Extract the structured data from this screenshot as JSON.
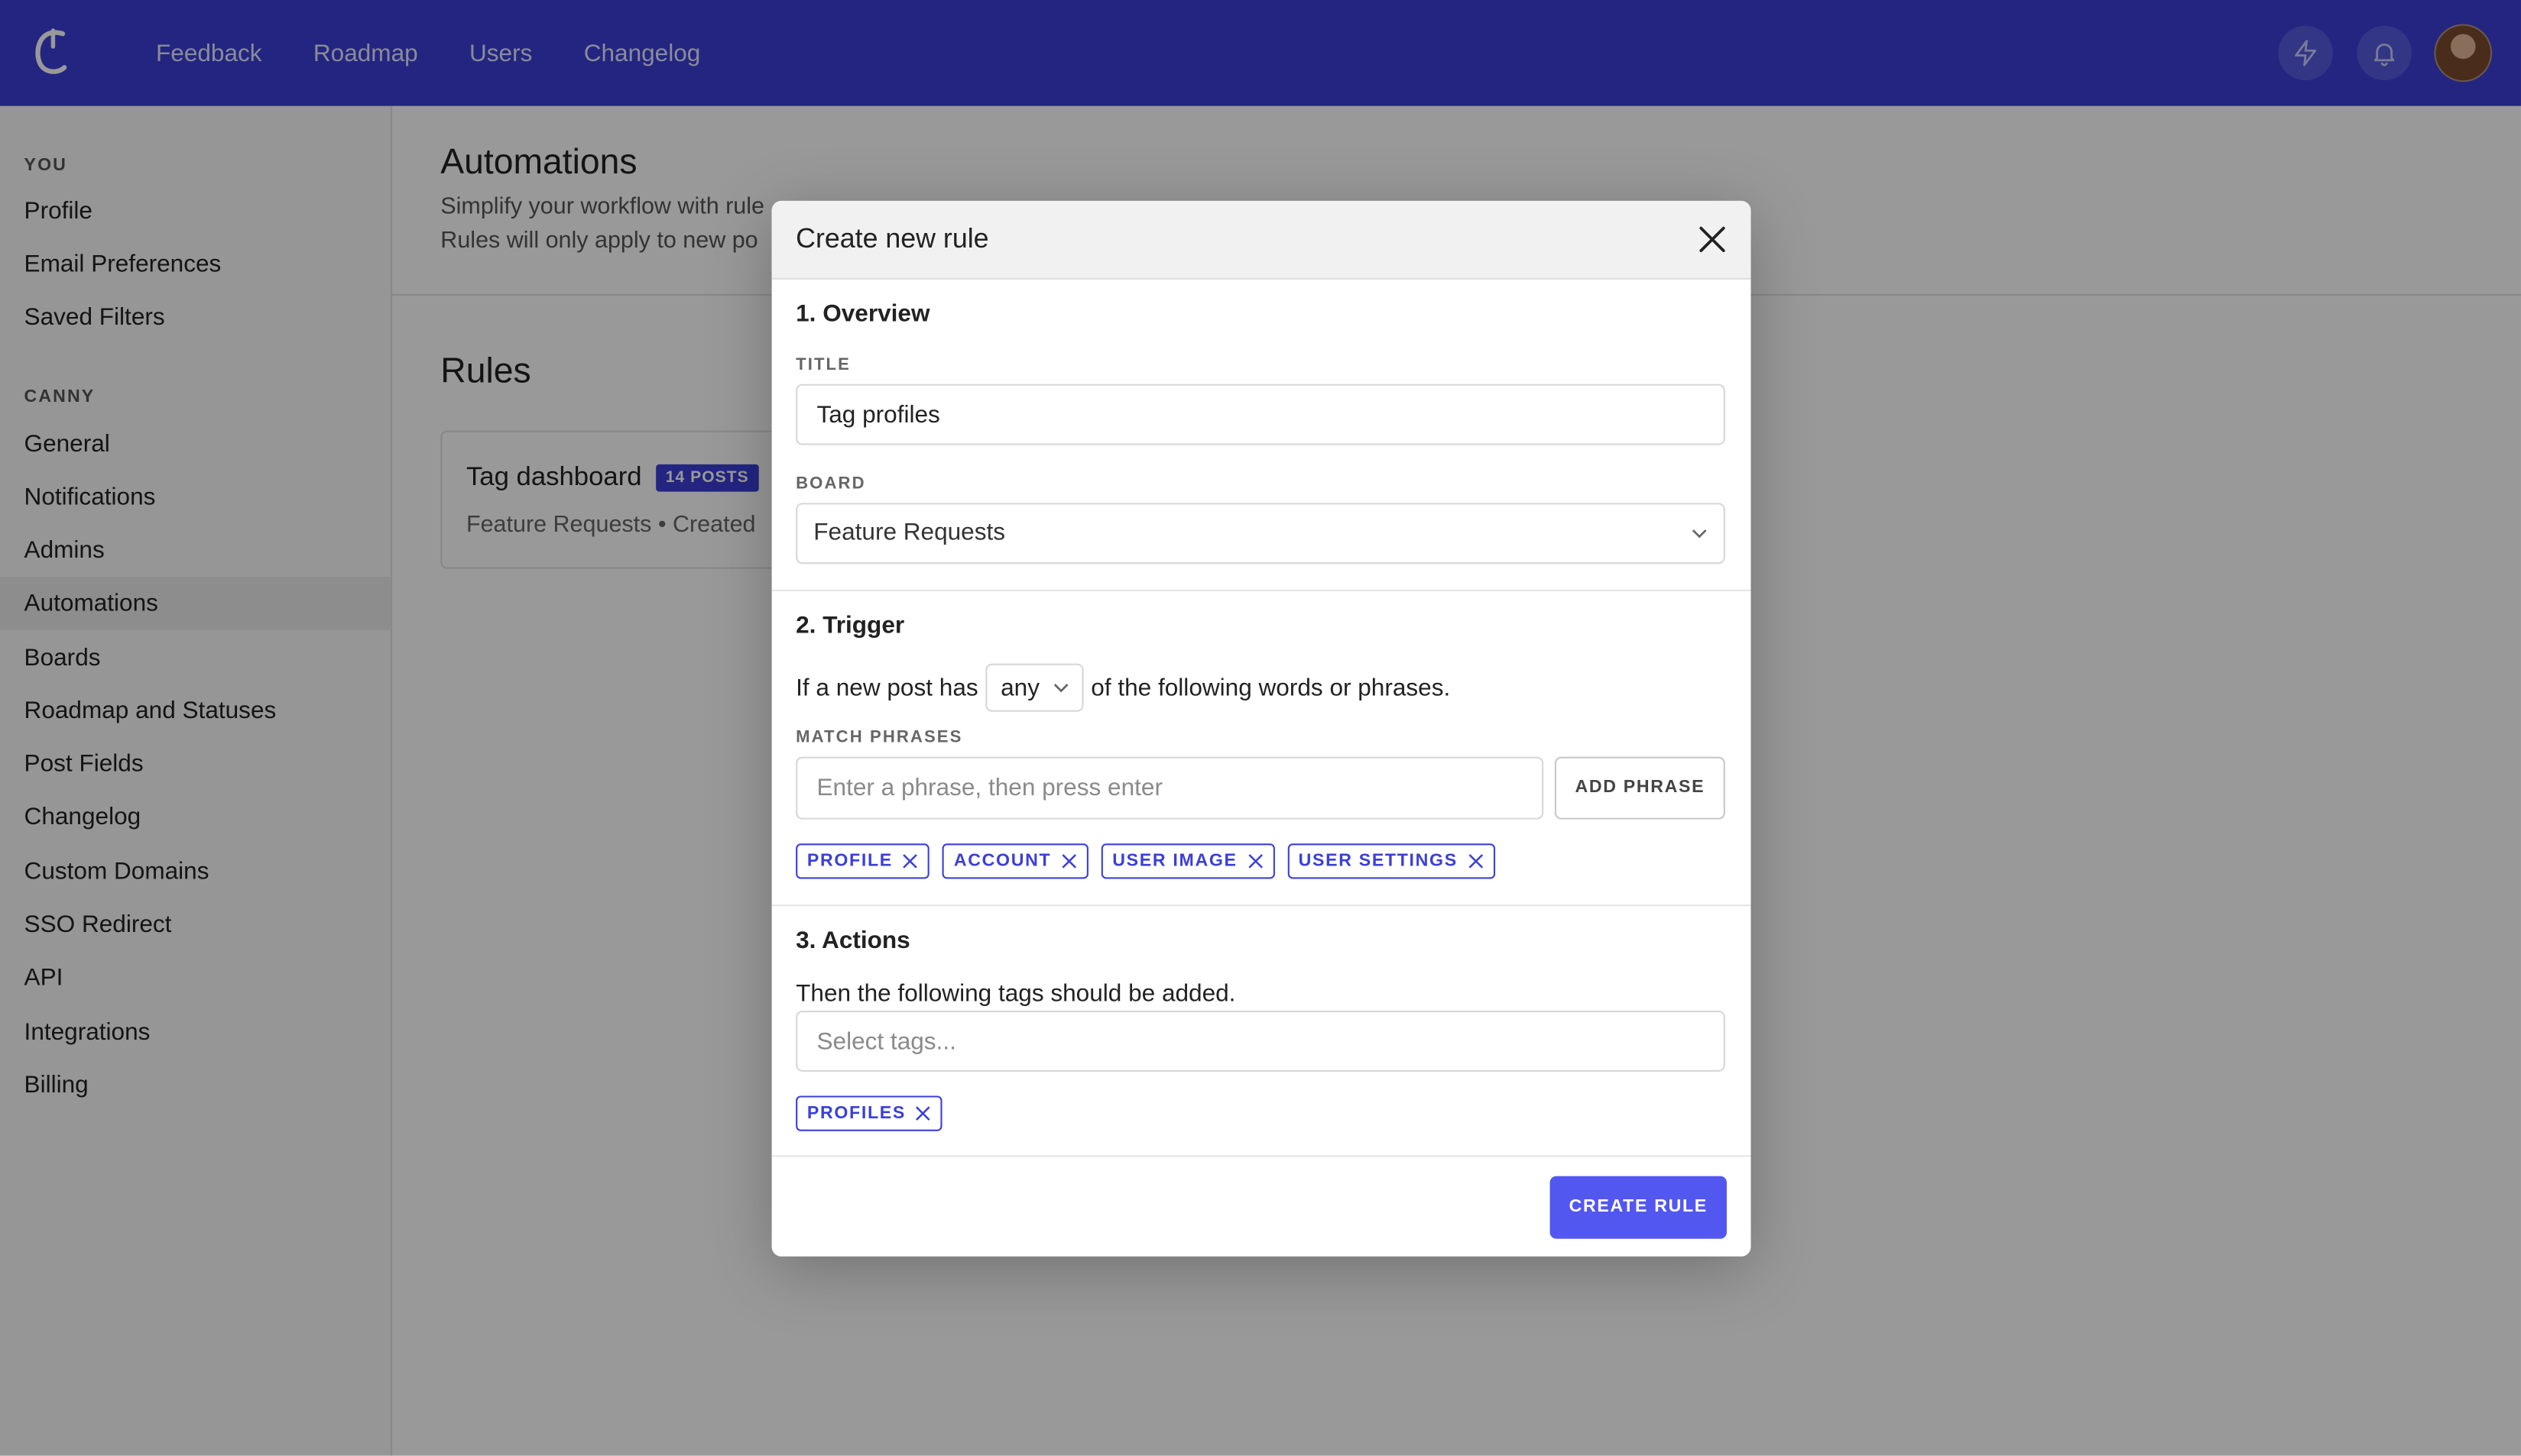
{
  "topbar": {
    "nav": [
      "Feedback",
      "Roadmap",
      "Users",
      "Changelog"
    ],
    "icons": [
      "canny-logo-icon",
      "lightning-icon",
      "bell-icon",
      "avatar"
    ]
  },
  "sidebar": {
    "sections": [
      {
        "label": "YOU",
        "items": [
          "Profile",
          "Email Preferences",
          "Saved Filters"
        ]
      },
      {
        "label": "CANNY",
        "items": [
          "General",
          "Notifications",
          "Admins",
          "Automations",
          "Boards",
          "Roadmap and Statuses",
          "Post Fields",
          "Changelog",
          "Custom Domains",
          "SSO Redirect",
          "API",
          "Integrations",
          "Billing"
        ]
      }
    ],
    "active_item": "Automations"
  },
  "content": {
    "title": "Automations",
    "subtitle_line1": "Simplify your workflow with rule",
    "subtitle_line2": "Rules will only apply to new po",
    "rules_title": "Rules",
    "rule": {
      "name": "Tag dashboard",
      "badge": "14 POSTS",
      "meta": "Feature Requests • Created"
    }
  },
  "modal": {
    "title": "Create new rule",
    "overview": {
      "heading": "1. Overview",
      "title_label": "TITLE",
      "title_value": "Tag profiles",
      "board_label": "BOARD",
      "board_value": "Feature Requests"
    },
    "trigger": {
      "heading": "2. Trigger",
      "text_before": "If a new post has",
      "match_mode": "any",
      "text_after": "of the following words or phrases.",
      "phrases_label": "MATCH PHRASES",
      "phrase_placeholder": "Enter a phrase, then press enter",
      "add_phrase_label": "ADD PHRASE",
      "phrases": [
        "PROFILE",
        "ACCOUNT",
        "USER IMAGE",
        "USER SETTINGS"
      ]
    },
    "actions": {
      "heading": "3. Actions",
      "text": "Then the following tags should be added.",
      "tags_placeholder": "Select tags...",
      "tags": [
        "PROFILES"
      ]
    },
    "submit_label": "CREATE RULE"
  },
  "colors": {
    "brand": "#3b3fd8",
    "button": "#5257f0"
  }
}
